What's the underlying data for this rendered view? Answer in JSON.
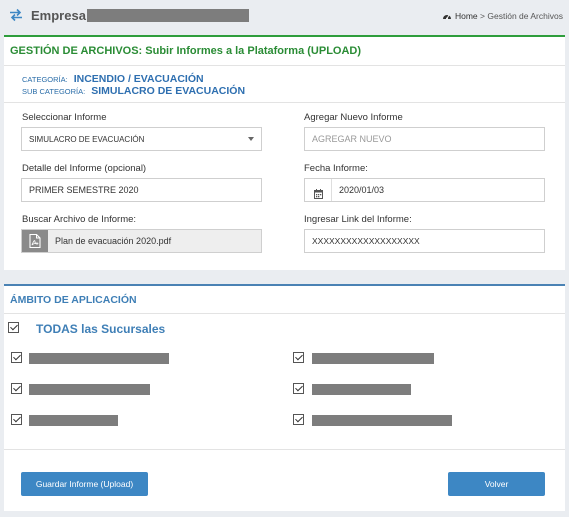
{
  "header": {
    "company_label": "Empresa:",
    "breadcrumb": {
      "home": "Home",
      "separator": ">",
      "current": "Gestión de Archivos"
    }
  },
  "form_panel": {
    "title": "GESTIÓN DE ARCHIVOS: Subir Informes a la Plataforma (UPLOAD)",
    "category_label": "CATEGORÍA:",
    "category_value": "INCENDIO / EVACUACIÓN",
    "subcategory_label": "SUB CATEGORÍA:",
    "subcategory_value": "SIMULACRO DE EVACUACIÓN",
    "fields": {
      "select_report": {
        "label": "Seleccionar Informe",
        "value": "SIMULACRO DE EVACUACIÓN"
      },
      "new_report": {
        "label": "Agregar Nuevo Informe",
        "placeholder": "AGREGAR NUEVO"
      },
      "detail": {
        "label": "Detalle del Informe (opcional)",
        "value": "PRIMER SEMESTRE 2020"
      },
      "date": {
        "label": "Fecha Informe:",
        "value": "2020/01/03"
      },
      "file": {
        "label": "Buscar Archivo de Informe:",
        "value": "Plan de evacuación 2020.pdf"
      },
      "link": {
        "label": "Ingresar Link del Informe:",
        "value": "XXXXXXXXXXXXXXXXXXX"
      }
    }
  },
  "scope_panel": {
    "title": "ÁMBITO DE APLICACIÓN",
    "all_branches_label": "TODAS las Sucursales",
    "all_checked": true,
    "branches_checked": [
      true,
      true,
      true,
      true,
      true,
      true
    ]
  },
  "actions": {
    "save_label": "Guardar Informe (Upload)",
    "back_label": "Volver"
  },
  "colors": {
    "accent_green": "#2a8c35",
    "accent_blue": "#3f7fb6",
    "button_blue": "#3d87c4",
    "redaction_gray": "#7d7d7d"
  }
}
